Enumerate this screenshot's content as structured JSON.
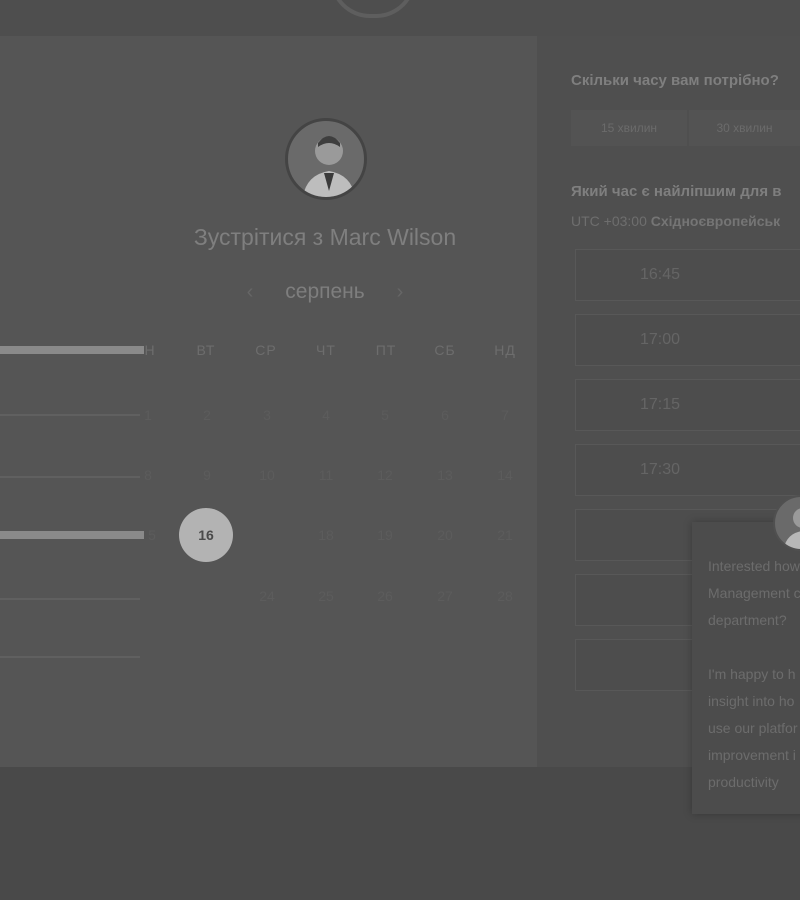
{
  "meeting": {
    "title_prefix": "Зустрітися з",
    "host_name": "Marc Wilson",
    "month": "серпень"
  },
  "calendar": {
    "weekdays": [
      "Н",
      "ВТ",
      "СР",
      "ЧТ",
      "ПТ",
      "СБ",
      "НД"
    ],
    "weeks": [
      [
        "1",
        "2",
        "3",
        "4",
        "5",
        "6",
        "7"
      ],
      [
        "8",
        "9",
        "10",
        "11",
        "12",
        "13",
        "14"
      ],
      [
        "5",
        "16",
        "",
        "18",
        "19",
        "20",
        "21"
      ],
      [
        "",
        "",
        "24",
        "25",
        "26",
        "27",
        "28"
      ]
    ],
    "selected_day": "16"
  },
  "duration": {
    "question": "Скільки часу вам потрібно?",
    "options": [
      "15 хвилин",
      "30 хвилин"
    ]
  },
  "time_select": {
    "question": "Який час є найліпшим для в",
    "tz_offset": "UTC +03:00",
    "tz_name": "Східноєвропейськ",
    "slots": [
      "16:45",
      "17:00",
      "17:15",
      "17:30"
    ]
  },
  "chat": {
    "lines_1": [
      "Interested how",
      "Management c",
      "department?"
    ],
    "lines_2": [
      "I'm happy to h",
      "insight into ho",
      "use our platfor",
      "improvement i",
      "productivity"
    ]
  },
  "colors": {
    "selected_day_bg": "#b3b3b3",
    "panel_left": "#555555",
    "panel_right": "#4f4f4f"
  }
}
